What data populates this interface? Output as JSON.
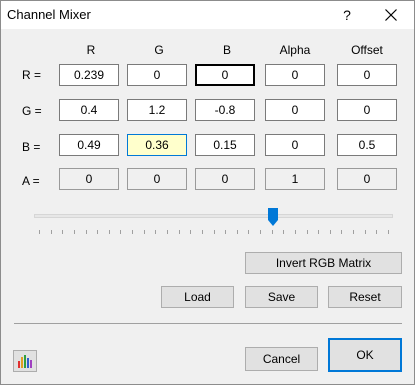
{
  "window": {
    "title": "Channel Mixer",
    "help_label": "?"
  },
  "matrix": {
    "columns": [
      "R",
      "G",
      "B",
      "Alpha",
      "Offset"
    ],
    "rows": [
      {
        "label": "R =",
        "values": [
          "0.239",
          "0",
          "0",
          "0",
          "0"
        ]
      },
      {
        "label": "G =",
        "values": [
          "0.4",
          "1.2",
          "-0.8",
          "0",
          "0"
        ]
      },
      {
        "label": "B =",
        "values": [
          "0.49",
          "0.36",
          "0.15",
          "0",
          "0.5"
        ]
      },
      {
        "label": "A =",
        "values": [
          "0",
          "0",
          "0",
          "1",
          "0"
        ]
      }
    ],
    "editable_rows": 3,
    "focused_cell": "R.B",
    "highlighted_cell": "B.G",
    "highlight_color": "#ffffcc"
  },
  "slider": {
    "value_fraction": 0.67,
    "tick_count": 31,
    "thumb_color": "#0078d7"
  },
  "buttons": {
    "invert": "Invert RGB Matrix",
    "load": "Load",
    "save": "Save",
    "reset": "Reset",
    "cancel": "Cancel",
    "ok": "OK"
  },
  "icons": {
    "close": "close-icon",
    "app": "color-bars-icon"
  }
}
